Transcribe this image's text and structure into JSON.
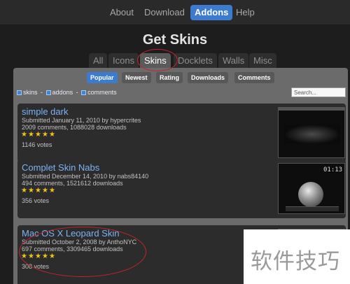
{
  "topnav": {
    "items": [
      {
        "label": "About",
        "active": false
      },
      {
        "label": "Download",
        "active": false
      },
      {
        "label": "Addons",
        "active": true
      },
      {
        "label": "Help",
        "active": false
      }
    ]
  },
  "page_title": "Get Skins",
  "category_tabs": [
    "All",
    "Icons",
    "Skins",
    "Docklets",
    "Walls",
    "Misc"
  ],
  "active_category": "Skins",
  "sort_tabs": [
    "Popular",
    "Newest",
    "Rating",
    "Downloads",
    "Comments"
  ],
  "active_sort": "Popular",
  "breadcrumb": {
    "items": [
      "skins",
      "addons",
      "comments"
    ],
    "separator": "-"
  },
  "search": {
    "placeholder": "Search..."
  },
  "items": [
    {
      "name": "simple dark",
      "submitted": "Submitted January 11, 2010 by hypercrites",
      "stats": "2009 comments, 1088028 downloads",
      "rating_stars": 5,
      "votes": "1146 votes"
    },
    {
      "name": "Complet Skin Nabs",
      "submitted": "Submitted December 14, 2010 by nabs84140",
      "stats": "494 comments, 1521612 downloads",
      "rating_stars": 5,
      "votes": "356 votes",
      "thumb_clock": "01:13"
    },
    {
      "name": "Mac OS X Leopard Skin",
      "submitted": "Submitted October 2, 2008 by AnthoNYC",
      "stats": "697 comments, 3309465 downloads",
      "rating_stars": 5,
      "votes": "308 votes"
    }
  ],
  "watermark": "软件技巧",
  "colors": {
    "accent": "#3d7bd1",
    "link": "#7cb3f2",
    "star": "#f0c419",
    "highlight_circle": "#c4262c"
  }
}
